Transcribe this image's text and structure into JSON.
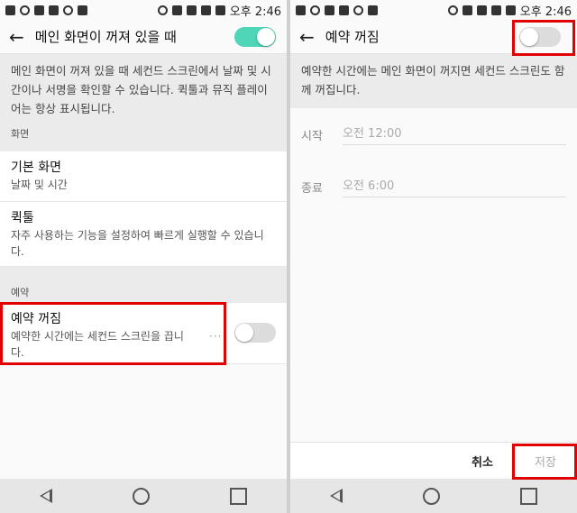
{
  "status": {
    "time": "오후 2:46"
  },
  "left": {
    "title": "메인 화면이 꺼져 있을 때",
    "description": "메인 화면이 꺼져 있을 때 세컨드 스크린에서 날짜 및 시간이나 서명을 확인할 수 있습니다. 퀵툴과 뮤직 플레이어는 항상 표시됩니다.",
    "section_screen": "화면",
    "items": [
      {
        "title": "기본 화면",
        "subtitle": "날짜 및 시간"
      },
      {
        "title": "퀵툴",
        "subtitle": "자주 사용하는 기능을 설정하여 빠르게 실행할 수 있습니다."
      }
    ],
    "section_schedule": "예약",
    "schedule_item": {
      "title": "예약 꺼짐",
      "subtitle": "예약한 시간에는 세컨드 스크린을 끕니다."
    }
  },
  "right": {
    "title": "예약 꺼짐",
    "description": "예약한 시간에는 메인 화면이 꺼지면 세컨드 스크린도 함께 꺼집니다.",
    "start_label": "시작",
    "start_value": "오전 12:00",
    "end_label": "종료",
    "end_value": "오전 6:00",
    "cancel": "취소",
    "save": "저장"
  },
  "colors": {
    "toggle_on": "#4fd5b7",
    "toggle_off": "#dcdcdc",
    "highlight": "#e00000"
  }
}
